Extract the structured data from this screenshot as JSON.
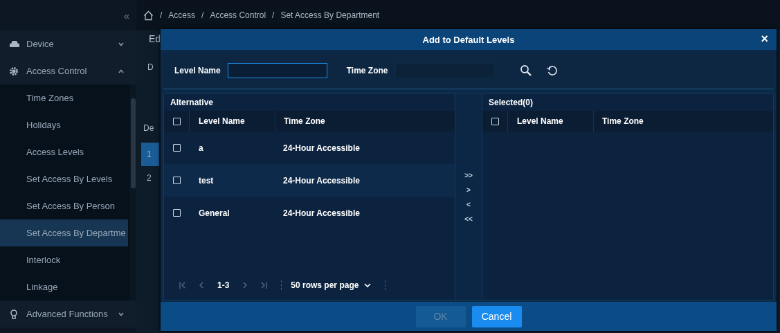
{
  "sidebar": {
    "collapse_glyph": "«",
    "items": [
      {
        "label": "Device",
        "expanded": false
      },
      {
        "label": "Access Control",
        "expanded": true,
        "children": [
          {
            "label": "Time Zones",
            "selected": false
          },
          {
            "label": "Holidays",
            "selected": false
          },
          {
            "label": "Access Levels",
            "selected": false
          },
          {
            "label": "Set Access By Levels",
            "selected": false
          },
          {
            "label": "Set Access By Person",
            "selected": false
          },
          {
            "label": "Set Access By Departme",
            "selected": true
          },
          {
            "label": "Interlock",
            "selected": false
          },
          {
            "label": "Linkage",
            "selected": false
          }
        ]
      },
      {
        "label": "Advanced Functions",
        "expanded": false
      }
    ]
  },
  "breadcrumb": [
    "/",
    "Access",
    "/",
    "Access Control",
    "/",
    "Set Access By Department"
  ],
  "background_page": {
    "heading": "Ed",
    "label": "D",
    "column_header": "De",
    "rows": [
      {
        "text": "1",
        "selected": true
      },
      {
        "text": "2",
        "selected": false
      }
    ]
  },
  "dialog": {
    "title": "Add to Default Levels",
    "close": "×",
    "filters": [
      {
        "label": "Level Name",
        "focused": true
      },
      {
        "label": "Time Zone",
        "focused": false
      }
    ],
    "alternative": {
      "title": "Alternative",
      "columns": [
        "Level Name",
        "Time Zone"
      ],
      "header_checked": false,
      "rows": [
        {
          "name": "a",
          "time_zone": "24-Hour Accessible",
          "checked": false
        },
        {
          "name": "test",
          "time_zone": "24-Hour Accessible",
          "checked": false
        },
        {
          "name": "General",
          "time_zone": "24-Hour Accessible",
          "checked": false
        }
      ],
      "pagination": {
        "range": "1-3",
        "page_size": "50 rows per page"
      }
    },
    "transfer_buttons": [
      ">>",
      ">",
      "<",
      "<<"
    ],
    "selected_panel": {
      "title": "Selected(0)",
      "columns": [
        "Level Name",
        "Time Zone"
      ],
      "header_checked": false
    },
    "buttons": [
      {
        "label": "OK",
        "disabled": true
      },
      {
        "label": "Cancel",
        "disabled": false
      }
    ]
  }
}
